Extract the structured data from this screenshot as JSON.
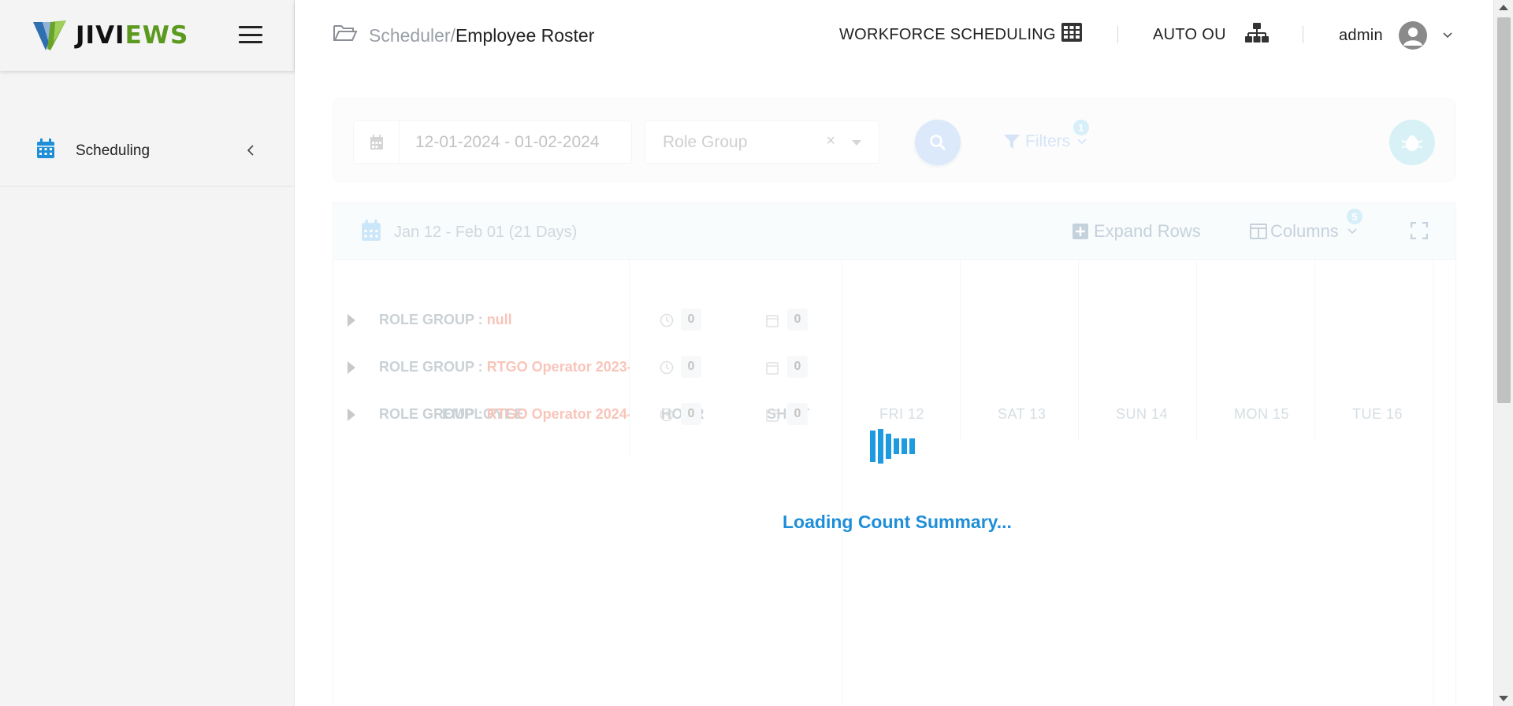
{
  "sidebar": {
    "logo": {
      "part1": "JIVI",
      "part2": "EWS"
    },
    "items": [
      {
        "label": "Scheduling",
        "icon": "calendar-icon"
      }
    ]
  },
  "header": {
    "breadcrumb": {
      "root": "Scheduler/",
      "current": "Employee Roster"
    },
    "module_label": "WORKFORCE SCHEDULING",
    "ou_label": "AUTO OU",
    "user_label": "admin"
  },
  "filters": {
    "date_range": "12-01-2024 - 01-02-2024",
    "role_group_placeholder": "Role Group",
    "clear_symbol": "×",
    "filters_label": "Filters",
    "filters_count": "1"
  },
  "grid": {
    "range_label": "Jan 12 - Feb 01 (21 Days)",
    "expand_rows_label": "Expand Rows",
    "columns_label": "Columns",
    "columns_count": "5",
    "headers": {
      "employee": "EMPLOYEE",
      "hour": "HOUR",
      "shift": "SHIFT"
    },
    "days": [
      "FRI 12",
      "SAT 13",
      "SUN 14",
      "MON 15",
      "TUE 16"
    ],
    "rows": [
      {
        "prefix": "ROLE GROUP : ",
        "name": "null",
        "hours": "0",
        "shifts": "0"
      },
      {
        "prefix": "ROLE GROUP : ",
        "name": "RTGO Operator 2023-",
        "hours": "0",
        "shifts": "0"
      },
      {
        "prefix": "ROLE GROUP : ",
        "name": "RTGO Operator 2024-",
        "hours": "0",
        "shifts": "0"
      }
    ]
  },
  "loading": {
    "text": "Loading Count Summary..."
  },
  "colors": {
    "accent": "#1e8ed8",
    "brand_green": "#5b9a1f",
    "role_name": "#ef5a3a"
  }
}
